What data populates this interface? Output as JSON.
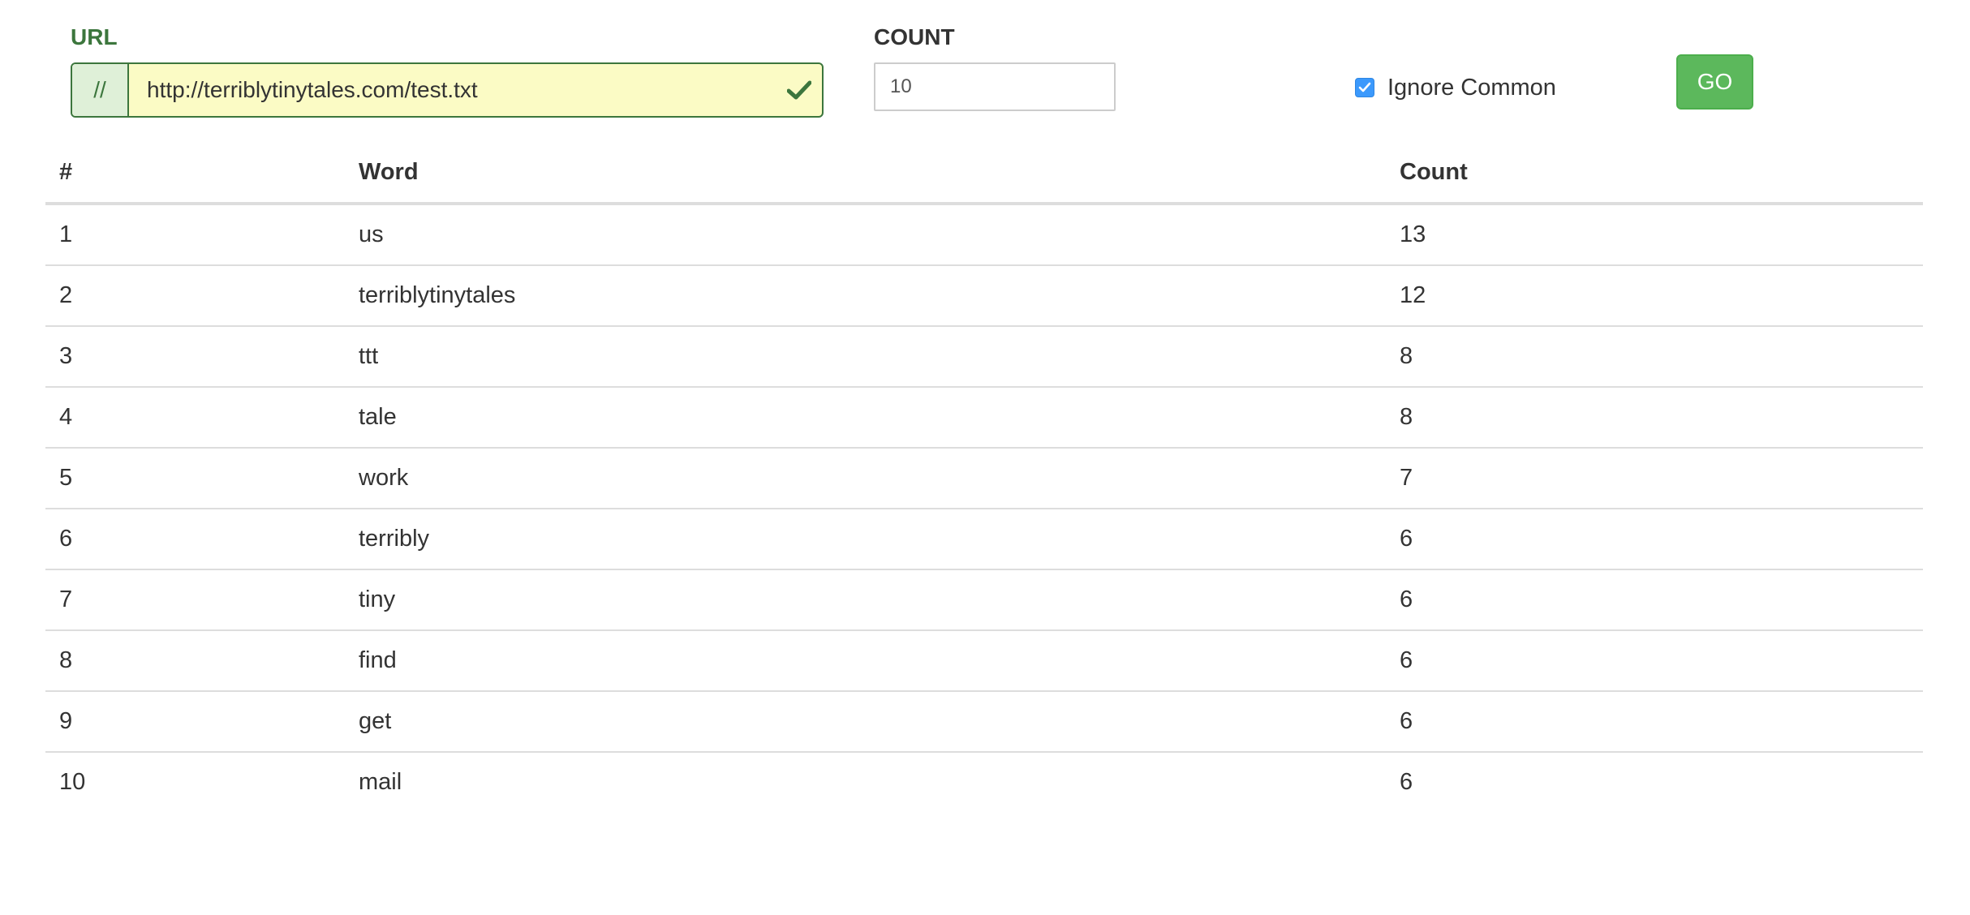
{
  "form": {
    "url_label": "URL",
    "url_prefix": "//",
    "url_value": "http://terriblytinytales.com/test.txt",
    "url_valid_icon": "checkmark-icon",
    "count_label": "COUNT",
    "count_value": "10",
    "ignore_common_label": "Ignore Common",
    "ignore_common_checked": true,
    "go_label": "GO"
  },
  "colors": {
    "success_green": "#3c763d",
    "button_green": "#5cb85c",
    "input_highlight": "#fbfbc5",
    "checkbox_blue": "#3b99fc"
  },
  "table": {
    "headers": [
      "#",
      "Word",
      "Count"
    ],
    "rows": [
      {
        "idx": "1",
        "word": "us",
        "count": "13"
      },
      {
        "idx": "2",
        "word": "terriblytinytales",
        "count": "12"
      },
      {
        "idx": "3",
        "word": "ttt",
        "count": "8"
      },
      {
        "idx": "4",
        "word": "tale",
        "count": "8"
      },
      {
        "idx": "5",
        "word": "work",
        "count": "7"
      },
      {
        "idx": "6",
        "word": "terribly",
        "count": "6"
      },
      {
        "idx": "7",
        "word": "tiny",
        "count": "6"
      },
      {
        "idx": "8",
        "word": "find",
        "count": "6"
      },
      {
        "idx": "9",
        "word": "get",
        "count": "6"
      },
      {
        "idx": "10",
        "word": "mail",
        "count": "6"
      }
    ]
  }
}
